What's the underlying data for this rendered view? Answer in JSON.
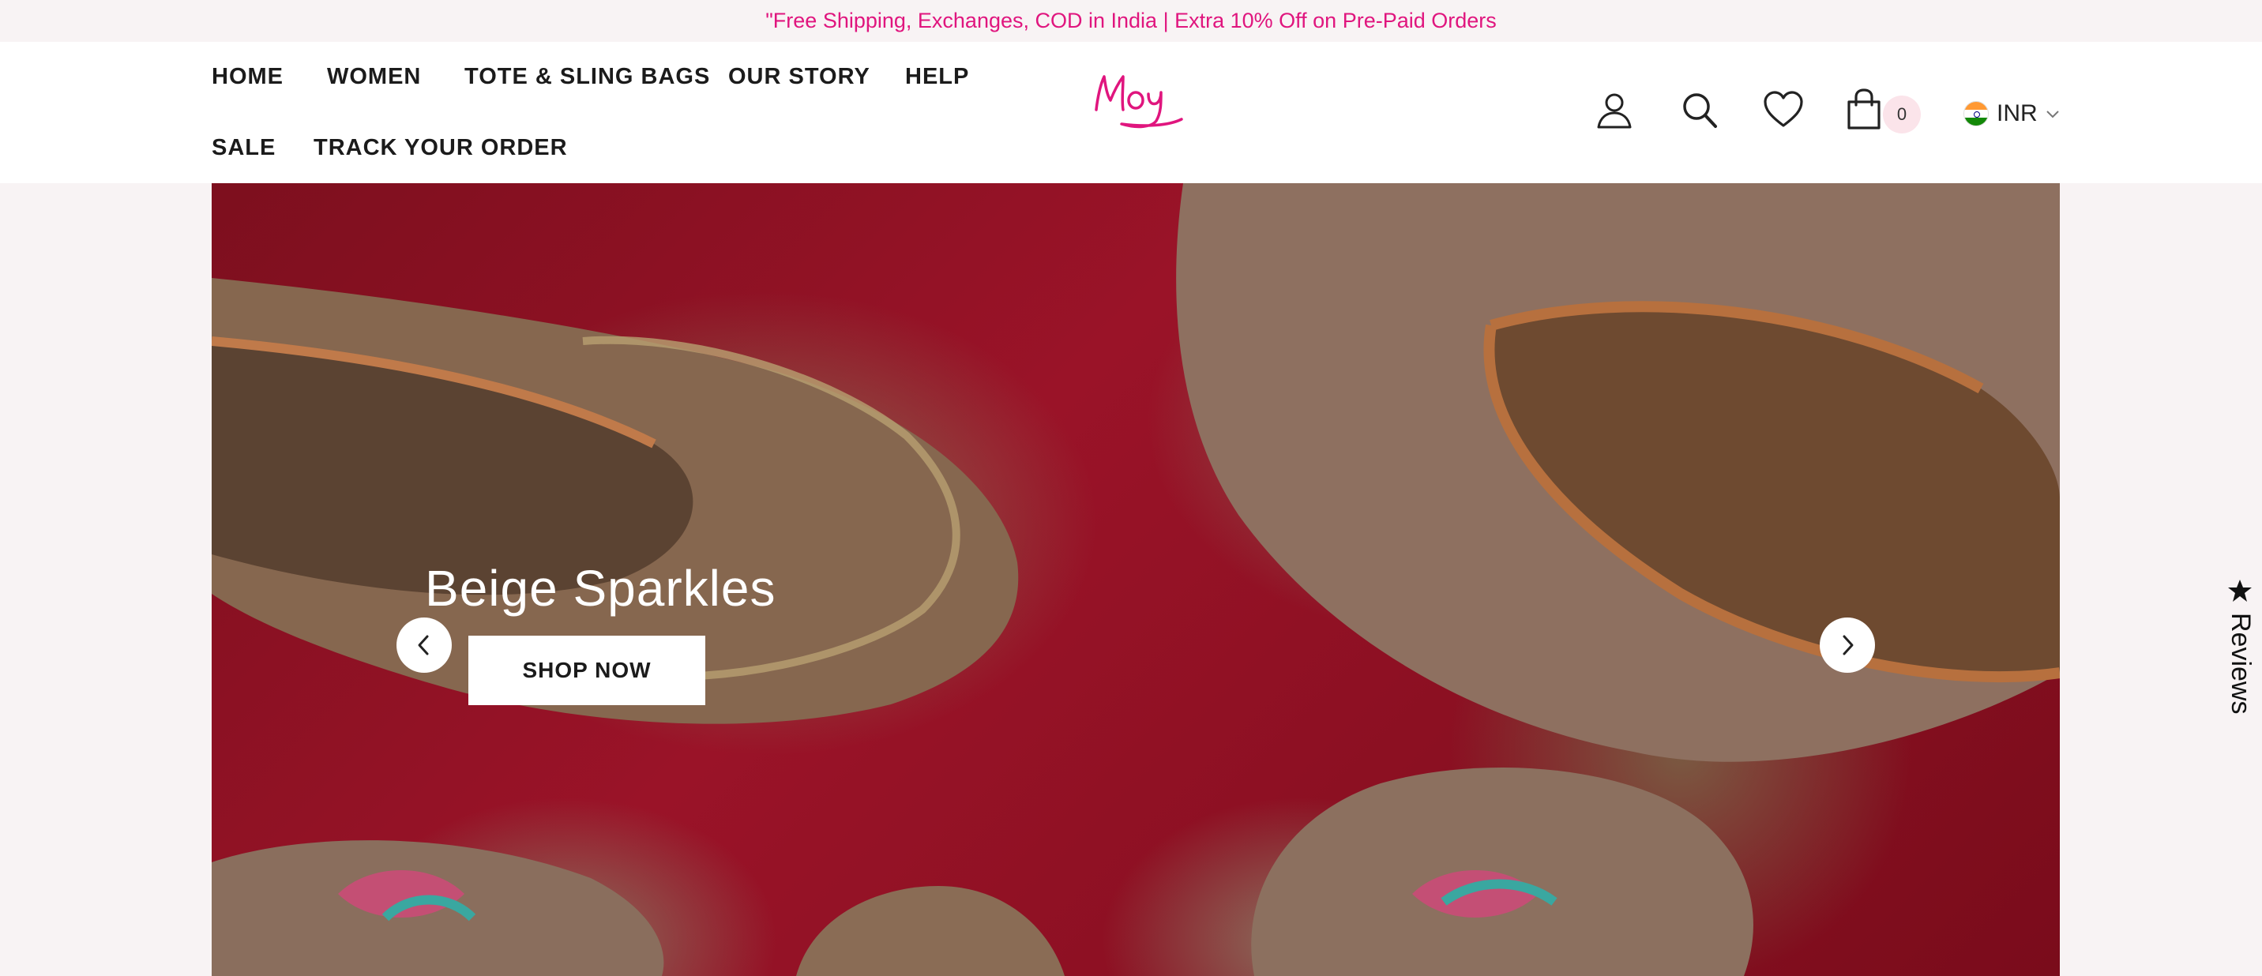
{
  "announcement": "\"Free Shipping, Exchanges, COD in India | Extra 10% Off on Pre-Paid Orders",
  "nav": {
    "home": "HOME",
    "women": "WOMEN",
    "tote": "TOTE & SLING BAGS",
    "story": "OUR STORY",
    "help": "HELP",
    "sale": "SALE",
    "track": "TRACK YOUR ORDER"
  },
  "brand": {
    "logo_text": "Moy",
    "accent": "#e0157e"
  },
  "header_icons": [
    "account-icon",
    "search-icon",
    "wishlist-heart-icon",
    "cart-bag-icon"
  ],
  "cart": {
    "count": "0"
  },
  "currency": {
    "code": "INR",
    "flag": "india-flag-icon"
  },
  "hero": {
    "title": "Beige Sparkles",
    "cta": "SHOP NOW",
    "image_subject": "embroidered beige juttis on red fabric"
  },
  "reviews_tab": {
    "label": "Reviews"
  },
  "colors": {
    "accent": "#e0157e",
    "text": "#1b1b1b",
    "background": "#f8f3f4"
  }
}
